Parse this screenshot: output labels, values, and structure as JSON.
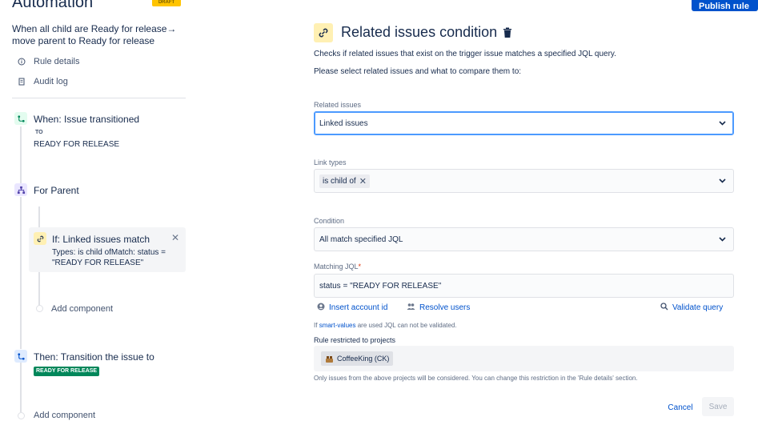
{
  "app": {
    "title": "Automation",
    "status_badge": "DRAFT"
  },
  "publish_button": "Publish rule",
  "rule": {
    "name": "When all child are Ready for release→ move parent to Ready for release"
  },
  "nav": [
    {
      "label": "Rule details",
      "icon": "info-icon"
    },
    {
      "label": "Audit log",
      "icon": "document-icon"
    }
  ],
  "components": {
    "trigger": {
      "title": "When: Issue transitioned",
      "to_label": "TO",
      "status": "READY FOR RELEASE",
      "icon": "transition-icon"
    },
    "branch": {
      "title": "For Parent",
      "icon": "branch-icon"
    },
    "condition": {
      "title": "If: Linked issues match",
      "detail": "Types: is child ofMatch: status = \"READY FOR RELEASE\"",
      "icon": "link-icon"
    },
    "add_inner": "Add component",
    "action": {
      "title": "Then: Transition the issue to",
      "status_lozenge": "READY FOR RELEASE",
      "icon": "transition-icon"
    },
    "add_outer": "Add component"
  },
  "panel": {
    "title": "Related issues condition",
    "description_1": "Checks if related issues that exist on the trigger issue matches a specified JQL query.",
    "description_2": "Please select related issues and what to compare them to:",
    "related_issues": {
      "label": "Related issues",
      "value": "Linked issues"
    },
    "link_types": {
      "label": "Link types",
      "tags": [
        "is child of"
      ]
    },
    "condition": {
      "label": "Condition",
      "value": "All match specified JQL"
    },
    "matching_jql": {
      "label": "Matching JQL",
      "required_mark": "*",
      "value": "status = \"READY FOR RELEASE\""
    },
    "actions": {
      "insert_account": "Insert account id",
      "resolve_users": "Resolve users",
      "validate_query": "Validate query"
    },
    "smart_values_note": {
      "prefix": "If",
      "link": "smart-values",
      "suffix": "are used JQL can not be validated."
    },
    "restricted": {
      "label": "Rule restricted to projects",
      "project": "CoffeeKing (CK)",
      "note": "Only issues from the above projects will be considered. You can change this restriction in the 'Rule details' section."
    },
    "cancel_button": "Cancel",
    "save_button": "Save"
  },
  "colors": {
    "brand_blue": "#0052cc",
    "focus_blue": "#4c9aff",
    "draft_yellow": "#ffc400",
    "status_green": "#00875a"
  }
}
